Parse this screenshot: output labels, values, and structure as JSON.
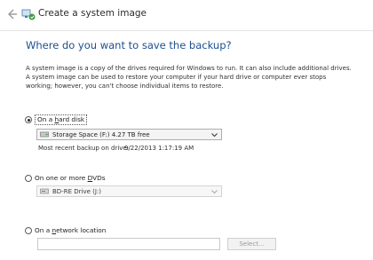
{
  "window": {
    "title": "Create a system image"
  },
  "page": {
    "heading": "Where do you want to save the backup?",
    "description": "A system image is a copy of the drives required for Windows to run. It can also include additional drives. A system image can be used to restore your computer if your hard drive or computer ever stops working; however, you can't choose individual items to restore."
  },
  "options": {
    "hard_disk": {
      "label_pre": "On a ",
      "label_accel": "h",
      "label_post": "ard disk",
      "selected": true,
      "drive": "Storage Space (F:)  4.27 TB free",
      "last_backup_label": "Most recent backup on drive:",
      "last_backup_value": "9/22/2013 1:17:19 AM"
    },
    "dvd": {
      "label_pre": "On one or more ",
      "label_accel": "D",
      "label_post": "VDs",
      "selected": false,
      "drive": "BD-RE Drive (J:)"
    },
    "network": {
      "label_pre": "On a ",
      "label_accel": "n",
      "label_post": "etwork location",
      "selected": false,
      "path_value": "",
      "select_button": "Select..."
    }
  },
  "icons": {
    "back": "back-arrow-icon",
    "title": "system-image-backup-icon",
    "drive": "hard-drive-icon",
    "optical": "optical-drive-icon",
    "caret": "chevron-down-icon"
  },
  "colors": {
    "heading": "#1d4f8f",
    "background": "#ffffff"
  }
}
